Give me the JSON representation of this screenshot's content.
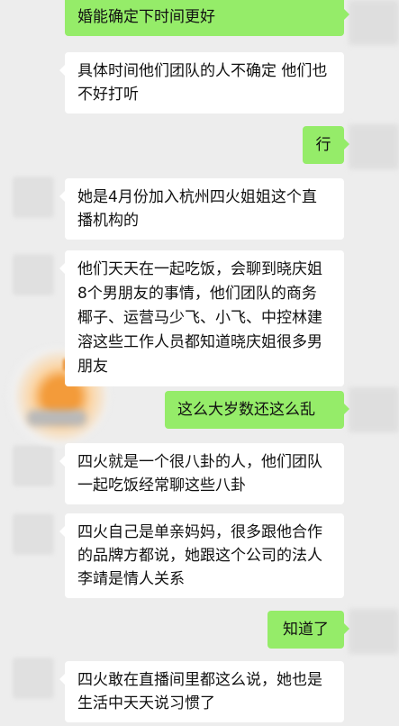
{
  "messages": [
    {
      "side": "out",
      "text": "婚能确定下时间更好"
    },
    {
      "side": "in",
      "text": "具体时间他们团队的人不确定 他们也不好打听"
    },
    {
      "side": "out",
      "text": "行"
    },
    {
      "side": "in",
      "text": "她是4月份加入杭州四火姐姐这个直播机构的"
    },
    {
      "side": "in",
      "text": "他们天天在一起吃饭，会聊到晓庆姐8个男朋友的事情，他们团队的商务椰子、运营马少飞、小飞、中控林建溶这些工作人员都知道晓庆姐很多男朋友"
    },
    {
      "side": "out",
      "text": "这么大岁数还这么乱"
    },
    {
      "side": "in",
      "text": "四火就是一个很八卦的人，他们团队一起吃饭经常聊这些八卦"
    },
    {
      "side": "in",
      "text": "四火自己是单亲妈妈，很多跟他合作的品牌方都说，她跟这个公司的法人李靖是情人关系"
    },
    {
      "side": "out",
      "text": "知道了"
    },
    {
      "side": "in",
      "text": "四火敢在直播间里都这么说，她也是生活中天天说习惯了"
    }
  ],
  "colors": {
    "background": "#ededed",
    "incoming_bubble": "#ffffff",
    "outgoing_bubble": "#95ec69"
  }
}
